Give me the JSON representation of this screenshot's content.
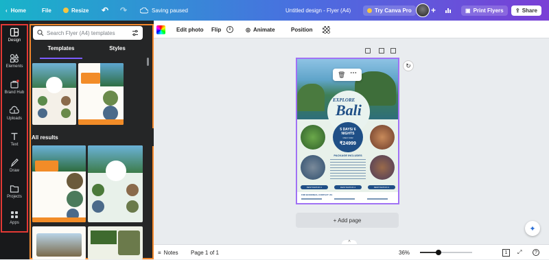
{
  "topbar": {
    "home_label": "Home",
    "file_label": "File",
    "resize_label": "Resize",
    "save_status": "Saving paused",
    "doc_title": "Untitled design - Flyer (A4)",
    "try_pro_label": "Try Canva Pro",
    "print_label": "Print Flyers",
    "share_label": "Share"
  },
  "rail": {
    "items": [
      {
        "label": "Design",
        "icon": "design-icon"
      },
      {
        "label": "Elements",
        "icon": "elements-icon"
      },
      {
        "label": "Brand Hub",
        "icon": "brand-hub-icon"
      },
      {
        "label": "Uploads",
        "icon": "uploads-icon"
      },
      {
        "label": "Text",
        "icon": "text-icon"
      },
      {
        "label": "Draw",
        "icon": "draw-icon"
      },
      {
        "label": "Projects",
        "icon": "projects-icon"
      },
      {
        "label": "Apps",
        "icon": "apps-icon"
      }
    ]
  },
  "panel": {
    "search_placeholder": "Search Flyer (A4) templates",
    "tabs": [
      "Templates",
      "Styles"
    ],
    "section_title": "All results"
  },
  "toolbar": {
    "edit_photo": "Edit photo",
    "flip": "Flip",
    "animate": "Animate",
    "position": "Position"
  },
  "flyer": {
    "explore": "EXPLORE",
    "place": "Bali",
    "days": "5 DAYS/ 6 NIGHTS",
    "price_prefix": "ONLY FOR",
    "price": "₹24999",
    "includes_title": "PACKAGE INCLUDES",
    "destination_buttons": [
      "DESTINATION 1",
      "DESTINATION 2",
      "DESTINATION 3"
    ],
    "contact_title": "FOR BOOKINGS, CONTACT US:"
  },
  "canvas": {
    "add_page_label": "+ Add page"
  },
  "bottombar": {
    "notes_label": "Notes",
    "page_label": "Page 1 of 1",
    "zoom_label": "36%",
    "page_count": "1",
    "zoom_level": 0.36
  },
  "colors": {
    "accent_purple": "#a071f5",
    "rail_outline": "#e53935",
    "panel_outline": "#f7892c",
    "flyer_navy": "#1f4f86"
  }
}
